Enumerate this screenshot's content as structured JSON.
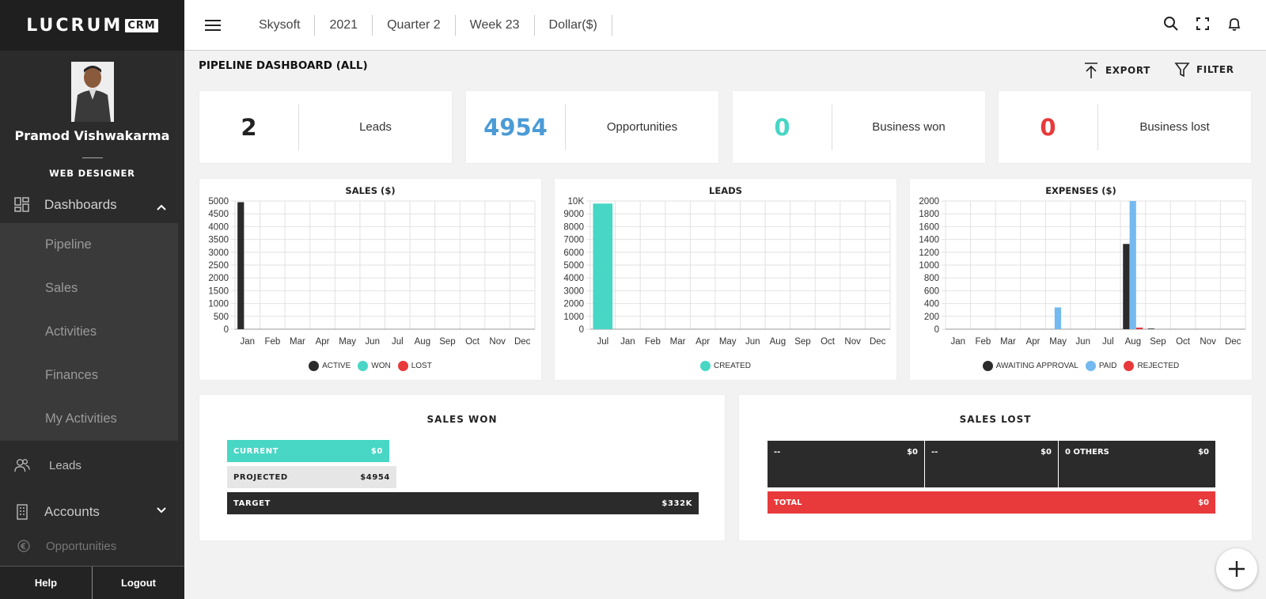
{
  "app": {
    "logo_text": "LUCRUM",
    "logo_badge": "CRM"
  },
  "profile": {
    "name": "Pramod Vishwakarma",
    "role": "WEB DESIGNER"
  },
  "sidebar": {
    "dashboards": "Dashboards",
    "sub_items": [
      "Pipeline",
      "Sales",
      "Activities",
      "Finances",
      "My Activities"
    ],
    "leads": "Leads",
    "accounts": "Accounts",
    "opportunities": "Opportunities",
    "help": "Help",
    "logout": "Logout"
  },
  "topbar": {
    "company": "Skysoft",
    "year": "2021",
    "quarter": "Quarter 2",
    "week": "Week 23",
    "currency": "Dollar($)"
  },
  "page": {
    "title": "PIPELINE DASHBOARD (ALL)",
    "export": "EXPORT",
    "filter": "FILTER"
  },
  "kpis": [
    {
      "value": "2",
      "label": "Leads",
      "color": "#222222"
    },
    {
      "value": "4954",
      "label": "Opportunities",
      "color": "#4a9bd6"
    },
    {
      "value": "0",
      "label": "Business won",
      "color": "#48d6c5"
    },
    {
      "value": "0",
      "label": "Business lost",
      "color": "#e8393b"
    }
  ],
  "chart_data": [
    {
      "type": "bar",
      "title": "SALES ($)",
      "categories": [
        "Jan",
        "Feb",
        "Mar",
        "Apr",
        "May",
        "Jun",
        "Jul",
        "Aug",
        "Sep",
        "Oct",
        "Nov",
        "Dec"
      ],
      "series": [
        {
          "name": "ACTIVE",
          "color": "#2b2b2b",
          "values": [
            4954,
            0,
            0,
            0,
            0,
            0,
            0,
            0,
            0,
            0,
            0,
            0
          ]
        },
        {
          "name": "WON",
          "color": "#48d6c5",
          "values": [
            0,
            0,
            0,
            0,
            0,
            0,
            0,
            0,
            0,
            0,
            0,
            0
          ]
        },
        {
          "name": "LOST",
          "color": "#e8393b",
          "values": [
            0,
            0,
            0,
            0,
            0,
            0,
            0,
            0,
            0,
            0,
            0,
            0
          ]
        }
      ],
      "yticks": [
        "5000",
        "4500",
        "4000",
        "3500",
        "3000",
        "2500",
        "2000",
        "1500",
        "1000",
        "500",
        "0"
      ],
      "ylim": [
        0,
        5000
      ],
      "grid": true,
      "legend": "bottom"
    },
    {
      "type": "bar",
      "title": "LEADS",
      "categories": [
        "Jul",
        "Jan",
        "Feb",
        "Mar",
        "Apr",
        "May",
        "Jun",
        "Aug",
        "Sep",
        "Oct",
        "Nov",
        "Dec"
      ],
      "series": [
        {
          "name": "CREATED",
          "color": "#48d6c5",
          "values": [
            9800,
            0,
            0,
            0,
            0,
            0,
            0,
            0,
            0,
            0,
            0,
            0
          ]
        }
      ],
      "yticks": [
        "10K",
        "9000",
        "8000",
        "7000",
        "6000",
        "5000",
        "4000",
        "3000",
        "2000",
        "1000",
        "0"
      ],
      "ylim": [
        0,
        10000
      ],
      "grid": true,
      "legend": "bottom"
    },
    {
      "type": "bar",
      "title": "EXPENSES ($)",
      "categories": [
        "Jan",
        "Feb",
        "Mar",
        "Apr",
        "May",
        "Jun",
        "Jul",
        "Aug",
        "Sep",
        "Oct",
        "Nov",
        "Dec"
      ],
      "series": [
        {
          "name": "AWAITING APPROVAL",
          "color": "#2b2b2b",
          "values": [
            0,
            0,
            0,
            0,
            0,
            0,
            0,
            1330,
            10,
            0,
            0,
            0
          ]
        },
        {
          "name": "PAID",
          "color": "#74b9ef",
          "values": [
            0,
            0,
            0,
            0,
            340,
            0,
            0,
            2000,
            0,
            0,
            0,
            0
          ]
        },
        {
          "name": "REJECTED",
          "color": "#e8393b",
          "values": [
            0,
            0,
            0,
            0,
            0,
            0,
            0,
            25,
            0,
            0,
            0,
            0
          ]
        }
      ],
      "yticks": [
        "2000",
        "1800",
        "1600",
        "1400",
        "1200",
        "1000",
        "800",
        "600",
        "400",
        "200",
        "0"
      ],
      "ylim": [
        0,
        2000
      ],
      "grid": true,
      "legend": "bottom"
    }
  ],
  "sales_won": {
    "title": "SALES WON",
    "current_label": "CURRENT",
    "current_value": "$0",
    "projected_label": "PROJECTED",
    "projected_value": "$4954",
    "target_label": "TARGET",
    "target_value": "$332K"
  },
  "sales_lost": {
    "title": "SALES LOST",
    "cells": [
      {
        "label": "--",
        "value": "$0"
      },
      {
        "label": "--",
        "value": "$0"
      },
      {
        "label": "0 OTHERS",
        "value": "$0"
      }
    ],
    "total_label": "TOTAL",
    "total_value": "$0"
  }
}
